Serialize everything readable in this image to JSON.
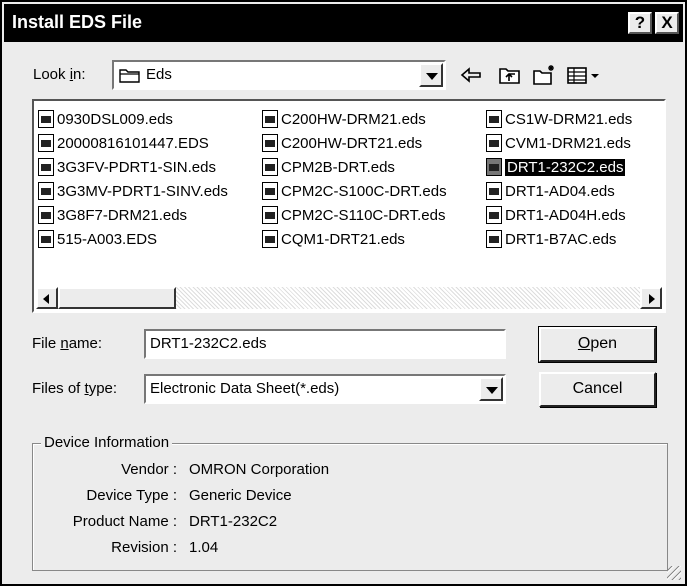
{
  "window": {
    "title": "Install EDS File"
  },
  "titlebar": {
    "help_label": "?",
    "close_label": "X"
  },
  "lookin": {
    "label_prefix": "Look ",
    "label_underlined": "i",
    "label_suffix": "n:",
    "value": "Eds"
  },
  "toolbar": {
    "icons": [
      "back-icon",
      "up-folder-icon",
      "new-folder-icon",
      "view-menu-icon"
    ]
  },
  "files": {
    "columns": [
      [
        "0930DSL009.eds",
        "20000816101447.EDS",
        "3G3FV-PDRT1-SIN.eds",
        "3G3MV-PDRT1-SINV.eds",
        "3G8F7-DRM21.eds",
        "515-A003.EDS"
      ],
      [
        "C200HW-DRM21.eds",
        "C200HW-DRT21.eds",
        "CPM2B-DRT.eds",
        "CPM2C-S100C-DRT.eds",
        "CPM2C-S110C-DRT.eds",
        "CQM1-DRT21.eds"
      ],
      [
        "CS1W-DRM21.eds",
        "CVM1-DRM21.eds",
        "DRT1-232C2.eds",
        "DRT1-AD04.eds",
        "DRT1-AD04H.eds",
        "DRT1-B7AC.eds"
      ]
    ],
    "selected": "DRT1-232C2.eds"
  },
  "filename": {
    "label_prefix": "File ",
    "label_underlined": "n",
    "label_suffix": "ame:",
    "value": "DRT1-232C2.eds"
  },
  "filetype": {
    "label_prefix": "Files of ",
    "label_underlined": "t",
    "label_suffix": "ype:",
    "value": "Electronic Data Sheet(*.eds)"
  },
  "buttons": {
    "open_underlined": "O",
    "open_rest": "pen",
    "cancel": "Cancel"
  },
  "device_info": {
    "legend": "Device Information",
    "rows": [
      {
        "label": "Vendor :",
        "value": "OMRON Corporation"
      },
      {
        "label": "Device Type :",
        "value": "Generic Device"
      },
      {
        "label": "Product Name :",
        "value": "DRT1-232C2"
      },
      {
        "label": "Revision :",
        "value": "1.04"
      }
    ]
  }
}
